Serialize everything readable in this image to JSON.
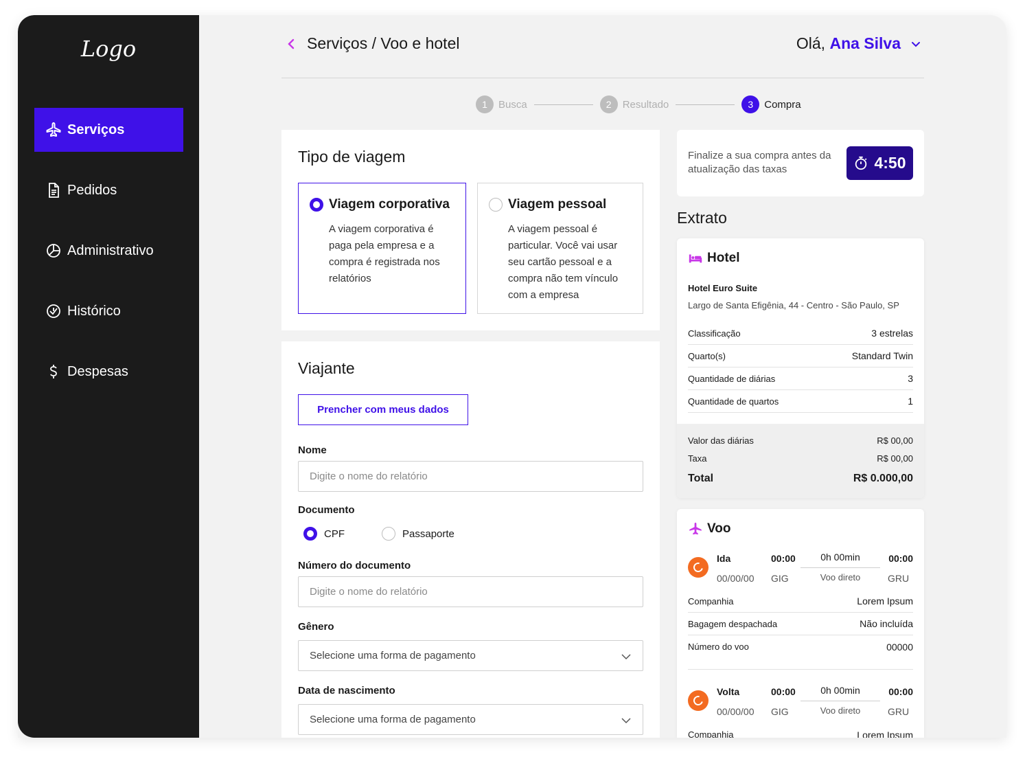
{
  "brand": {
    "logo_text": "Logo",
    "accent": "#3f11e8",
    "sidebar_bg": "#1b1b1b"
  },
  "sidebar": {
    "items": [
      {
        "label": "Serviços",
        "icon": "airplane-icon",
        "active": true
      },
      {
        "label": "Pedidos",
        "icon": "document-icon",
        "active": false
      },
      {
        "label": "Administrativo",
        "icon": "pie-chart-icon",
        "active": false
      },
      {
        "label": "Histórico",
        "icon": "history-icon",
        "active": false
      },
      {
        "label": "Despesas",
        "icon": "dollar-icon",
        "active": false
      }
    ]
  },
  "header": {
    "breadcrumb": "Serviços / Voo e hotel",
    "greeting": "Olá,",
    "user_name": "Ana Silva"
  },
  "stepper": [
    {
      "num": "1",
      "label": "Busca",
      "state": "done"
    },
    {
      "num": "2",
      "label": "Resultado",
      "state": "done"
    },
    {
      "num": "3",
      "label": "Compra",
      "state": "active"
    }
  ],
  "trip_type": {
    "title": "Tipo de viagem",
    "options": [
      {
        "title": "Viagem corporativa",
        "desc": "A viagem corporativa é paga pela empresa e a compra é registrada nos relatórios",
        "selected": true
      },
      {
        "title": "Viagem pessoal",
        "desc": "A viagem pessoal é particular. Você vai usar seu cartão pessoal e a compra não tem vínculo com a empresa",
        "selected": false
      }
    ]
  },
  "traveler": {
    "title": "Viajante",
    "fill_button": "Prencher com meus dados",
    "name_label": "Nome",
    "name_placeholder": "Digite o nome do relatório",
    "doc_label": "Documento",
    "doc_options": [
      {
        "label": "CPF",
        "selected": true
      },
      {
        "label": "Passaporte",
        "selected": false
      }
    ],
    "doc_number_label": "Número do documento",
    "doc_number_placeholder": "Digite o nome do relatório",
    "gender_label": "Gênero",
    "gender_value": "Selecione uma forma de pagamento",
    "birth_label": "Data de nascimento",
    "birth_value": "Selecione uma forma de pagamento"
  },
  "timer": {
    "text": "Finalize a sua compra antes da atualização das taxas",
    "value": "4:50"
  },
  "extrato": {
    "title": "Extrato",
    "hotel": {
      "heading": "Hotel",
      "name": "Hotel Euro Suite",
      "address": "Largo de Santa Efigênia, 44 - Centro - São Paulo, SP",
      "rows": [
        {
          "k": "Classificação",
          "v": "3 estrelas"
        },
        {
          "k": "Quarto(s)",
          "v": "Standard Twin"
        },
        {
          "k": "Quantidade de diárias",
          "v": "3"
        },
        {
          "k": "Quantidade de quartos",
          "v": "1"
        }
      ],
      "daily_label": "Valor das diárias",
      "daily_value": "R$ 00,00",
      "tax_label": "Taxa",
      "tax_value": "R$ 00,00",
      "total_label": "Total",
      "total_value": "R$ 0.000,00"
    },
    "flight": {
      "heading": "Voo",
      "legs": [
        {
          "dir": "Ida",
          "date": "00/00/00",
          "dep_time": "00:00",
          "dep_airport": "GIG",
          "duration": "0h 00min",
          "type": "Voo direto",
          "arr_time": "00:00",
          "arr_airport": "GRU"
        },
        {
          "dir": "Volta",
          "date": "00/00/00",
          "dep_time": "00:00",
          "dep_airport": "GIG",
          "duration": "0h 00min",
          "type": "Voo direto",
          "arr_time": "00:00",
          "arr_airport": "GRU"
        }
      ],
      "rows": [
        {
          "k": "Companhia",
          "v": "Lorem Ipsum"
        },
        {
          "k": "Bagagem despachada",
          "v": "Não incluída"
        },
        {
          "k": "Número do voo",
          "v": "00000"
        }
      ],
      "second_company_label": "Companhia",
      "second_company_value": "Lorem Ipsum"
    }
  }
}
